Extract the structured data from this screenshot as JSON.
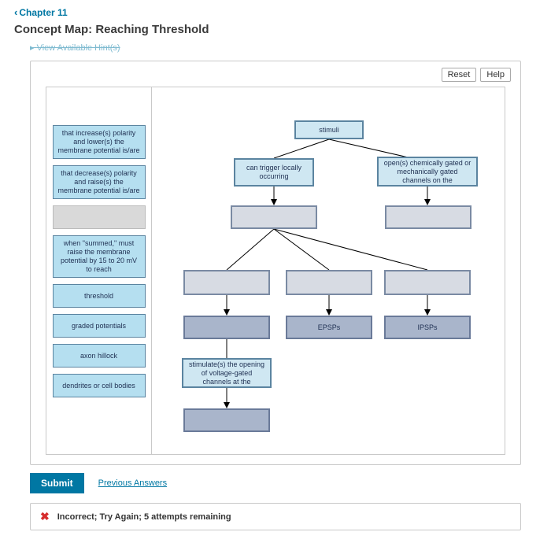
{
  "nav": {
    "chapter_label": "Chapter 11"
  },
  "title": "Concept Map: Reaching Threshold",
  "hints_label": "View Available Hint(s)",
  "toolbar": {
    "reset": "Reset",
    "help": "Help"
  },
  "palette": {
    "items": [
      "that increase(s) polarity and lower(s) the membrane potential is/are",
      "that decrease(s) polarity and raise(s) the membrane potential is/are",
      "",
      "when \"summed,\" must raise the membrane potential by 15 to 20 mV to reach",
      "threshold",
      "graded potentials",
      "axon hillock",
      "dendrites or cell bodies"
    ]
  },
  "nodes": {
    "stimuli": "stimuli",
    "trigger": "can trigger locally occurring",
    "open_channels": "open(s) chemically gated or mechanically gated channels on the",
    "epsps": "EPSPs",
    "ipsps": "IPSPs",
    "stimulate": "stimulate(s) the opening of voltage-gated channels at the"
  },
  "footer": {
    "submit": "Submit",
    "previous": "Previous Answers"
  },
  "feedback": {
    "text": "Incorrect; Try Again; 5 attempts remaining"
  }
}
